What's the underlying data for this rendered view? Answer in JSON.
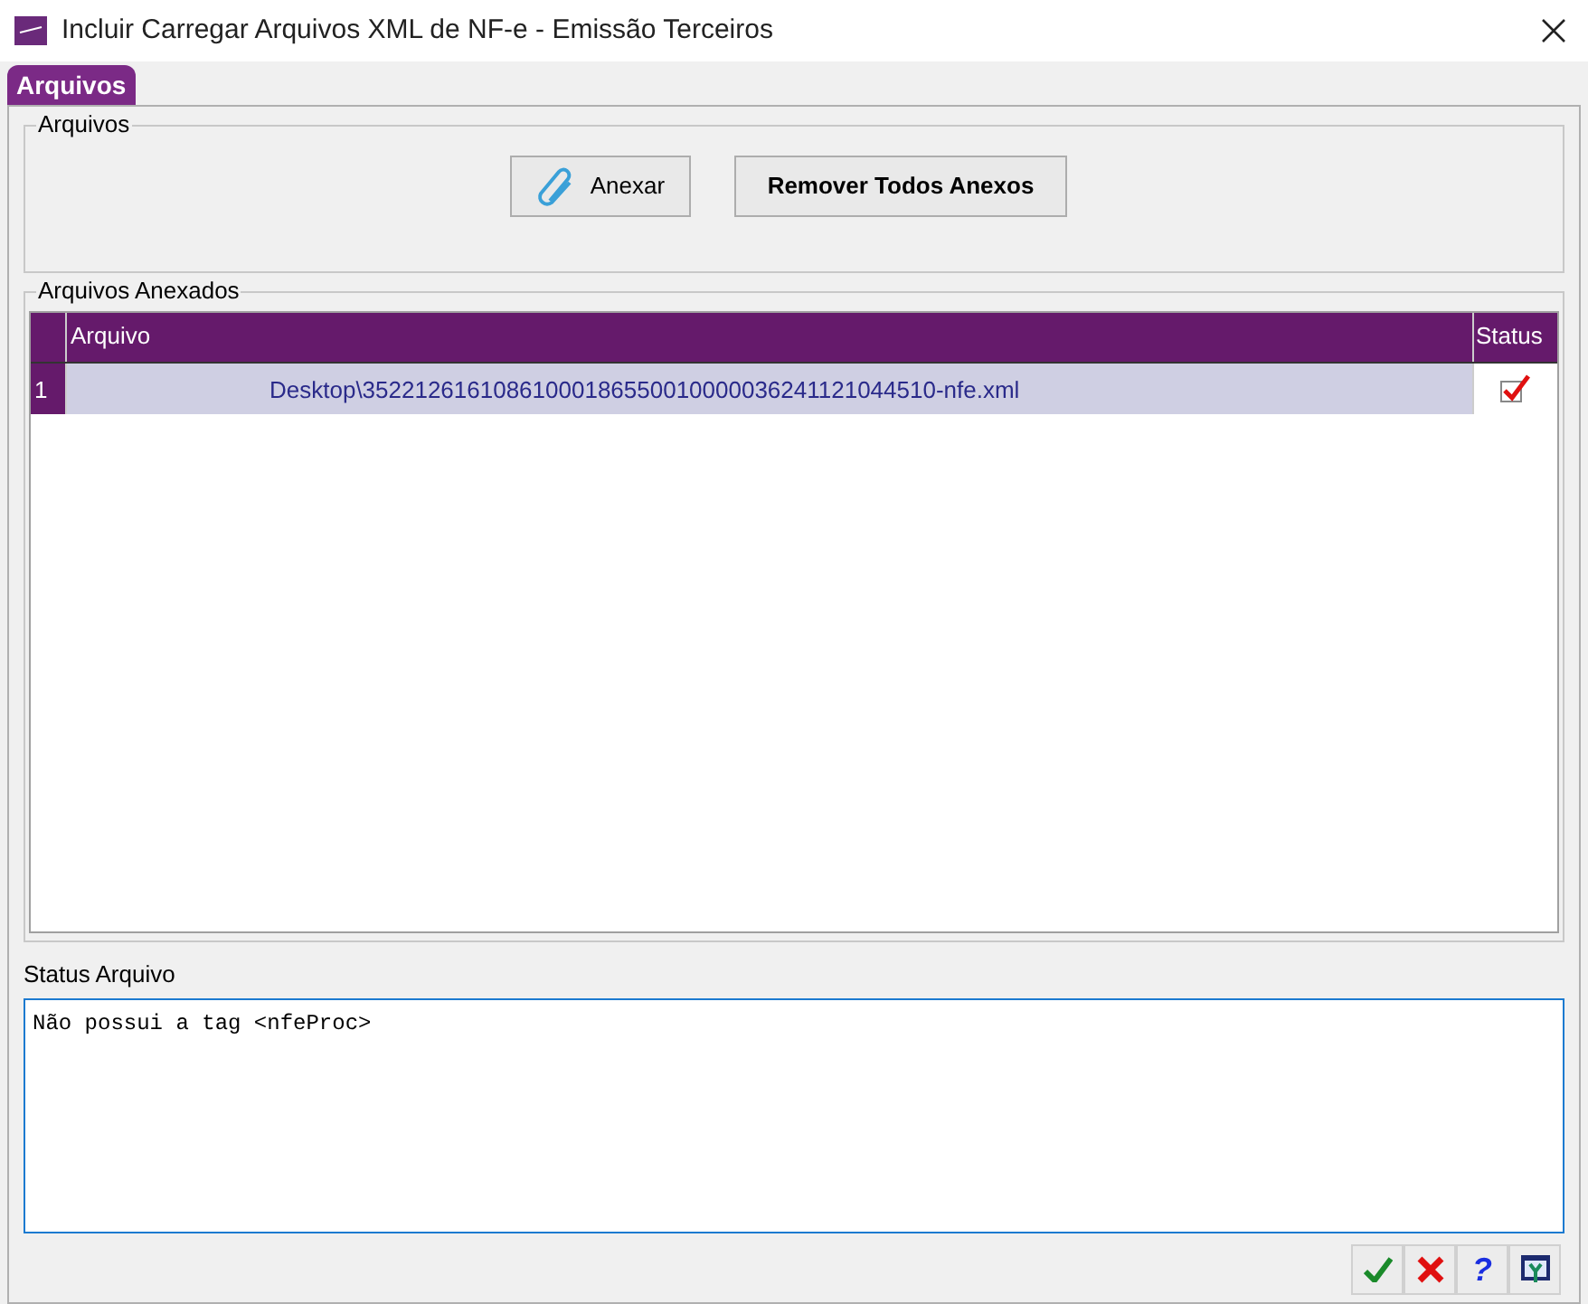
{
  "window": {
    "title": "Incluir Carregar Arquivos XML de NF-e - Emissão Terceiros"
  },
  "tabs": [
    {
      "label": "Arquivos",
      "selected": true
    }
  ],
  "files_group": {
    "legend": "Arquivos",
    "buttons": [
      {
        "label": "Anexar",
        "kind": "clip"
      },
      {
        "label": "Remover Todos Anexos",
        "kind": "plain"
      }
    ]
  },
  "attached_group": {
    "legend": "Arquivos Anexados",
    "table": {
      "columns": [
        "Arquivo",
        "Status"
      ],
      "rows": [
        {
          "index": "1",
          "file": "Desktop\\35221261610861000186550010000036241121044510-nfe.xml",
          "checked": true,
          "selected": true
        }
      ]
    }
  },
  "status_file": {
    "label": "Status Arquivo",
    "value": "Não possui a tag <nfeProc>"
  },
  "toolbar": [
    {
      "kind": "ok"
    },
    {
      "kind": "cancel"
    },
    {
      "kind": "help",
      "text": "?"
    },
    {
      "kind": "tool"
    }
  ]
}
